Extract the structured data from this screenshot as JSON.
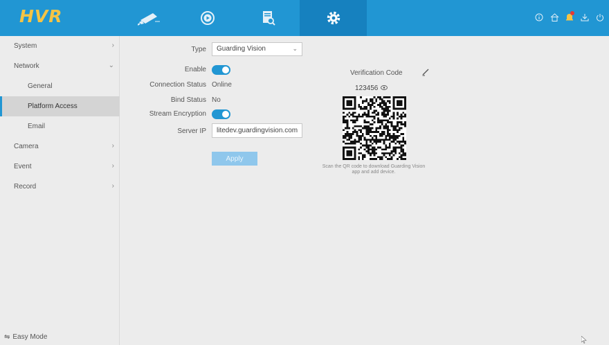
{
  "app": {
    "logo": "HVR"
  },
  "topnav": {
    "tabs": [
      "Live View",
      "Playback",
      "Search",
      "Settings"
    ],
    "active": "Settings"
  },
  "colors": {
    "topbar": "#2196d3",
    "accent": "#2196d3",
    "logo": "#f5c445",
    "notification": "#e53935"
  },
  "sidebar": {
    "items": [
      {
        "label": "System"
      },
      {
        "label": "Network"
      },
      {
        "label": "General"
      },
      {
        "label": "Platform Access",
        "active": true
      },
      {
        "label": "Email"
      },
      {
        "label": "Camera"
      },
      {
        "label": "Event"
      },
      {
        "label": "Record"
      }
    ],
    "easy_mode": "Easy Mode"
  },
  "form": {
    "type_label": "Type",
    "type_value": "Guarding Vision",
    "enable_label": "Enable",
    "enable_on": true,
    "conn_label": "Connection Status",
    "conn_value": "Online",
    "bind_label": "Bind Status",
    "bind_value": "No",
    "stream_label": "Stream Encryption",
    "stream_on": true,
    "server_label": "Server IP",
    "server_value": "litedev.guardingvision.com",
    "apply_label": "Apply"
  },
  "verification": {
    "label": "Verification Code",
    "code": "123456",
    "qr_caption_line1": "Scan the QR code to download Guarding Vision",
    "qr_caption_line2": "app and add device."
  }
}
